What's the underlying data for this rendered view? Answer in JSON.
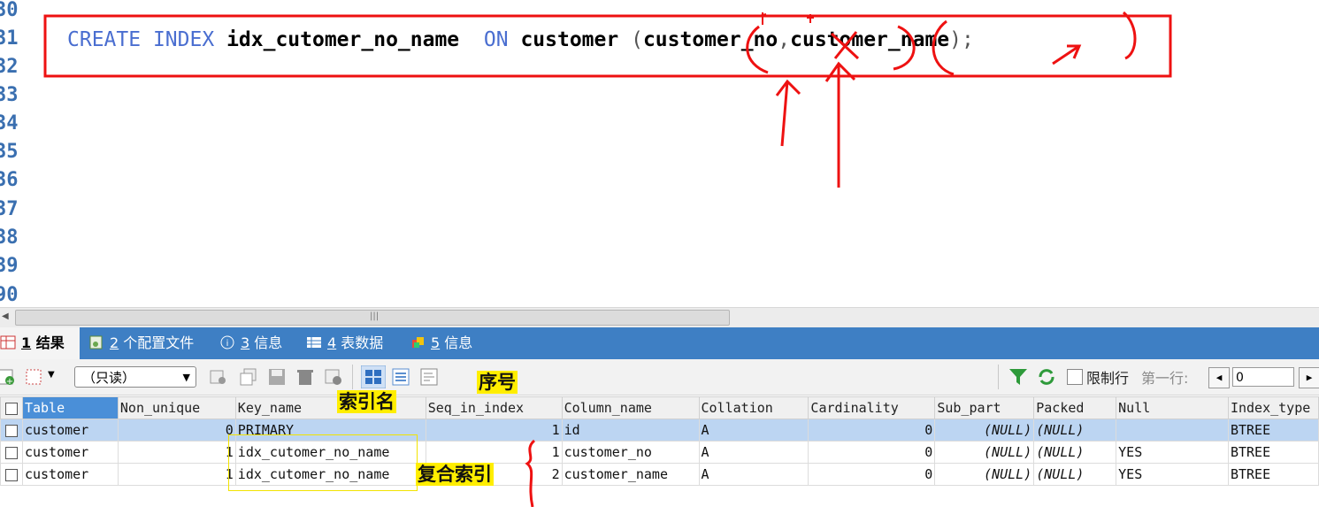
{
  "editor": {
    "line_numbers": [
      "30",
      "31",
      "32",
      "33",
      "34",
      "35",
      "36",
      "37",
      "38",
      "39",
      "90"
    ],
    "code": {
      "kw_create": "CREATE",
      "kw_index": "INDEX",
      "index_name": "idx_cutomer_no_name",
      "kw_on": "ON",
      "table": "customer",
      "open_paren": "(",
      "col1": "customer_no",
      "comma": ",",
      "col2": "customer_name",
      "close": ");"
    }
  },
  "tabs": [
    {
      "num": "1",
      "label": " 结果",
      "icon": "result-grid-icon"
    },
    {
      "num": "2",
      "label": " 个配置文件",
      "icon": "profile-icon"
    },
    {
      "num": "3",
      "label": " 信息",
      "icon": "info-icon"
    },
    {
      "num": "4",
      "label": " 表数据",
      "icon": "table-data-icon"
    },
    {
      "num": "5",
      "label": " 信息",
      "icon": "info-icon"
    }
  ],
  "toolbar": {
    "mode_select": "（只读）",
    "limit_rows_label": "限制行",
    "first_row_label": "第一行:",
    "first_row_value": "0"
  },
  "grid": {
    "columns": [
      "Table",
      "Non_unique",
      "Key_name",
      "Seq_in_index",
      "Column_name",
      "Collation",
      "Cardinality",
      "Sub_part",
      "Packed",
      "Null",
      "Index_type"
    ],
    "rows": [
      [
        "customer",
        "0",
        "PRIMARY",
        "1",
        "id",
        "A",
        "0",
        "(NULL)",
        "(NULL)",
        "",
        "BTREE"
      ],
      [
        "customer",
        "1",
        "idx_cutomer_no_name",
        "1",
        "customer_no",
        "A",
        "0",
        "(NULL)",
        "(NULL)",
        "YES",
        "BTREE"
      ],
      [
        "customer",
        "1",
        "idx_cutomer_no_name",
        "2",
        "customer_name",
        "A",
        "0",
        "(NULL)",
        "(NULL)",
        "YES",
        "BTREE"
      ]
    ]
  },
  "annotations": {
    "index_name_label": "索引名",
    "seq_label": "序号",
    "composite_label": "复合索引"
  },
  "colors": {
    "keyword": "#4a6ed0",
    "tab_bar": "#3e7fc4",
    "selected_row": "#bcd5f2",
    "annotation_red": "#ee1111",
    "highlight_yellow": "#ffee00"
  }
}
